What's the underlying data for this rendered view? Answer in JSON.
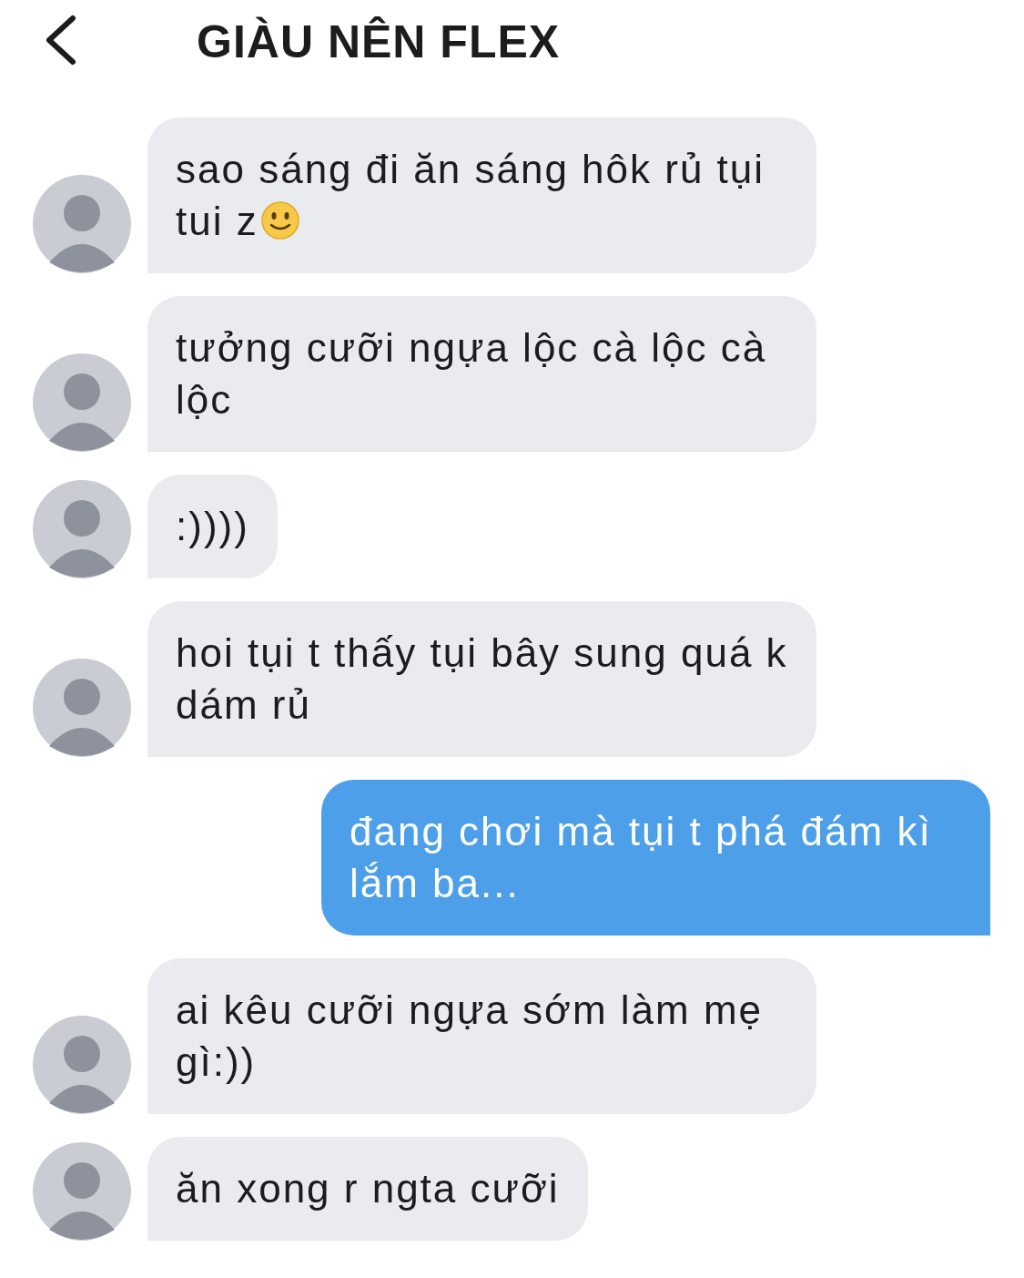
{
  "header": {
    "title": "GIÀU NÊN FLEX"
  },
  "messages": [
    {
      "kind": "incoming",
      "text": "sao sáng đi ăn sáng hôk rủ tụi tui z",
      "emoji": true
    },
    {
      "kind": "incoming",
      "text": "tưởng cưỡi ngựa lộc cà lộc cà lộc"
    },
    {
      "kind": "incoming",
      "text": ":))))"
    },
    {
      "kind": "incoming",
      "text": "hoi tụi t thấy tụi bây sung quá k dám rủ"
    },
    {
      "kind": "outgoing",
      "text": "đang chơi mà tụi t phá đám kì lắm ba..."
    },
    {
      "kind": "incoming",
      "text": "ai kêu cưỡi ngựa sớm làm mẹ gì:))"
    },
    {
      "kind": "incoming",
      "text": "ăn xong r ngta cưỡi"
    }
  ]
}
